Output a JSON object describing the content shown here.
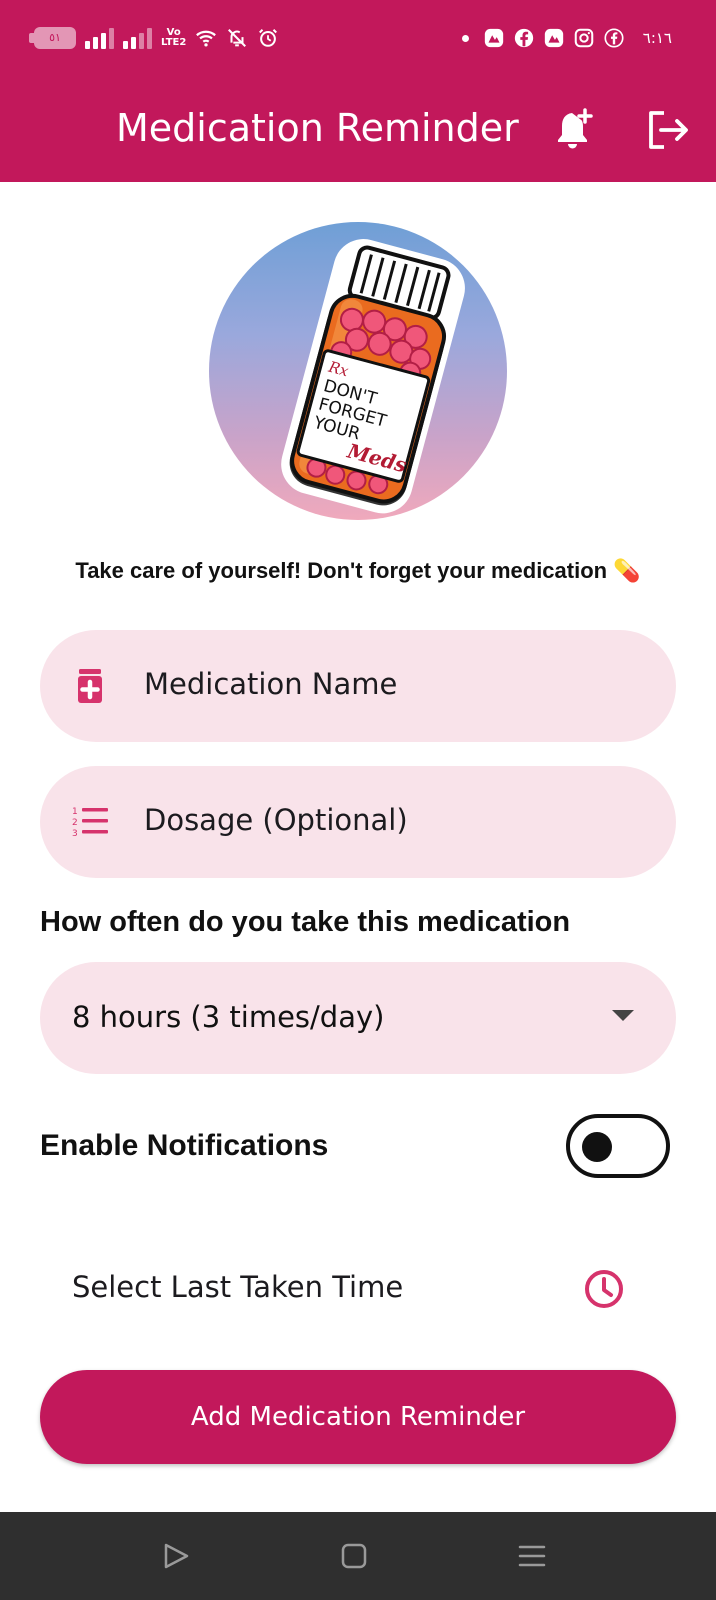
{
  "status_bar": {
    "battery_level": "٥١",
    "volte_line1": "Vo",
    "volte_line2": "LTE2",
    "time": "٦:١٦",
    "icons": [
      "battery-icon",
      "signal-icon",
      "signal-icon",
      "volte-icon",
      "wifi-icon",
      "bell-off-icon",
      "alarm-icon",
      "dot-icon",
      "gallery-icon",
      "facebook-icon",
      "gallery-icon",
      "instagram-icon",
      "facebook-icon"
    ]
  },
  "app_bar": {
    "title": "Medication Reminder",
    "actions": [
      "add-alarm-icon",
      "logout-icon"
    ],
    "color": "#c2185b"
  },
  "hero": {
    "label_rx": "Rx",
    "label_lines": [
      "DON'T",
      "FORGET",
      "YOUR"
    ],
    "label_script": "Meds"
  },
  "tagline": "Take care of yourself! Don't forget your medication 💊",
  "form": {
    "medication_name_placeholder": "Medication Name",
    "dosage_placeholder": "Dosage (Optional)",
    "frequency_question": "How often do you take this medication",
    "frequency_selected": "8 hours (3 times/day)",
    "notifications_label": "Enable Notifications",
    "notifications_enabled": false,
    "last_taken_label": "Select Last Taken Time",
    "submit_label": "Add Medication Reminder"
  },
  "colors": {
    "primary": "#c2185b",
    "field_bg": "#f9e3ea",
    "nav_bg": "#2f2f2f"
  }
}
